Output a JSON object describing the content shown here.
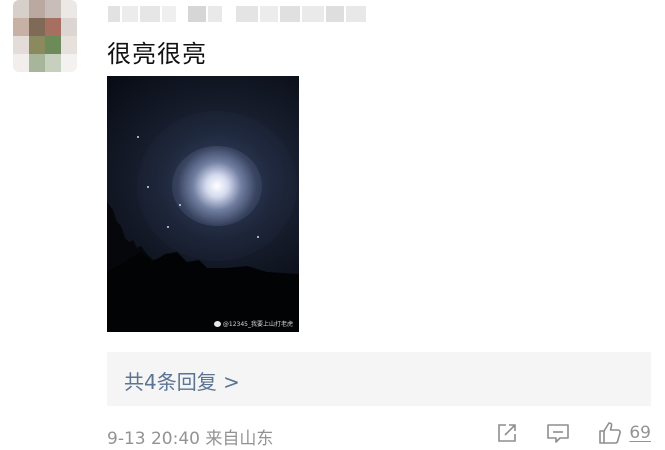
{
  "comment": {
    "text": "很亮很亮",
    "replies_label": "共4条回复 >",
    "timestamp": "9-13 20:40",
    "location": "来自山东",
    "like_count": "69",
    "photo_watermark": "@12345_我要上山打老虎"
  },
  "icons": {
    "share": "share-icon",
    "comment": "comment-icon",
    "like": "thumbs-up-icon"
  },
  "colors": {
    "link_blue": "#5b7493",
    "meta_gray": "#939393",
    "reply_bg": "#f5f5f5"
  }
}
